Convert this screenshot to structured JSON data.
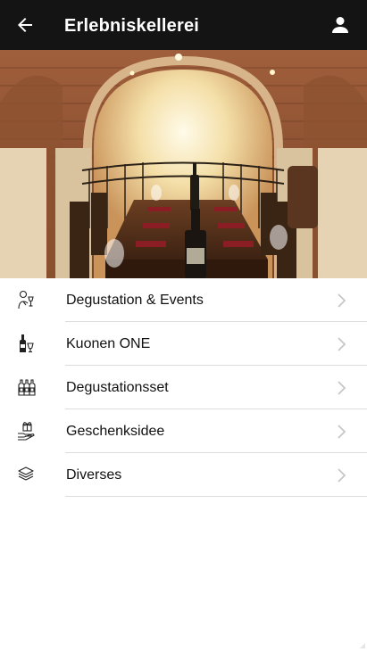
{
  "header": {
    "title": "Erlebniskellerei",
    "back_icon": "arrow-left-icon",
    "profile_icon": "person-icon",
    "background": "#141414"
  },
  "hero": {
    "description_icon": "wine-cellar-photo"
  },
  "menu": {
    "items": [
      {
        "label": "Degustation & Events",
        "icon": "person-wine-icon"
      },
      {
        "label": "Kuonen ONE",
        "icon": "wine-bottle-glass-icon"
      },
      {
        "label": "Degustationsset",
        "icon": "wine-bottles-set-icon"
      },
      {
        "label": "Geschenksidee",
        "icon": "gift-hand-icon"
      },
      {
        "label": "Diverses",
        "icon": "layers-icon"
      }
    ]
  },
  "colors": {
    "topbar": "#141414",
    "divider": "#dcdcdc",
    "chevron": "#c7c7c7",
    "text": "#111111"
  }
}
